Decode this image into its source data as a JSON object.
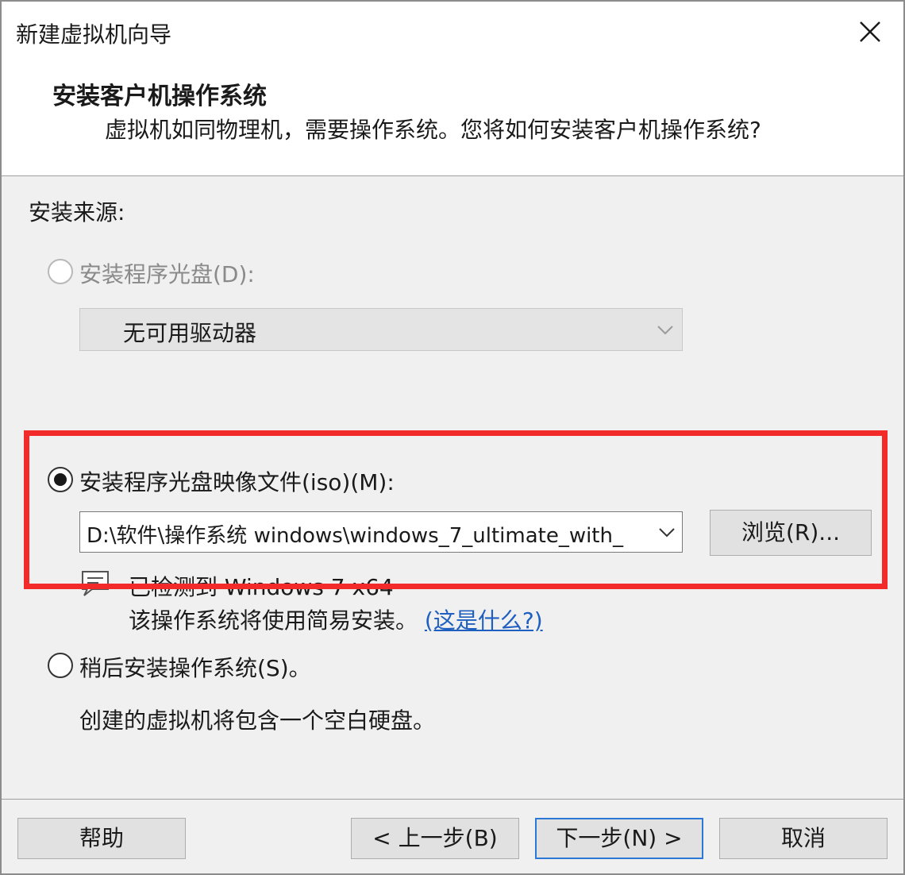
{
  "window": {
    "title": "新建虚拟机向导"
  },
  "header": {
    "title": "安装客户机操作系统",
    "subtitle": "虚拟机如同物理机，需要操作系统。您将如何安装客户机操作系统?"
  },
  "source": {
    "label": "安装来源:",
    "disc": {
      "label": "安装程序光盘(D):",
      "selected": false,
      "enabled": false,
      "value": "无可用驱动器"
    },
    "iso": {
      "label": "安装程序光盘映像文件(iso)(M):",
      "selected": true,
      "value": "D:\\软件\\操作系统  windows\\windows_7_ultimate_with_",
      "browse_label": "浏览(R)..."
    },
    "detected_text": "已检测到 Windows 7 x64",
    "easy_install_text": "该操作系统将使用简易安装。",
    "easy_install_link": "(这是什么?)",
    "later": {
      "label": "稍后安装操作系统(S)。",
      "selected": false,
      "description": "创建的虚拟机将包含一个空白硬盘。"
    }
  },
  "footer": {
    "help_label": "帮助",
    "back_label": "< 上一步(B)",
    "next_label": "下一步(N) >",
    "cancel_label": "取消"
  },
  "colors": {
    "highlight": "#f22a2a",
    "link": "#1f5fbf",
    "default_button_border": "#2b78d8"
  },
  "icons": {
    "close": "close-icon",
    "info": "info-icon",
    "dropdown": "chevron-down-icon"
  }
}
